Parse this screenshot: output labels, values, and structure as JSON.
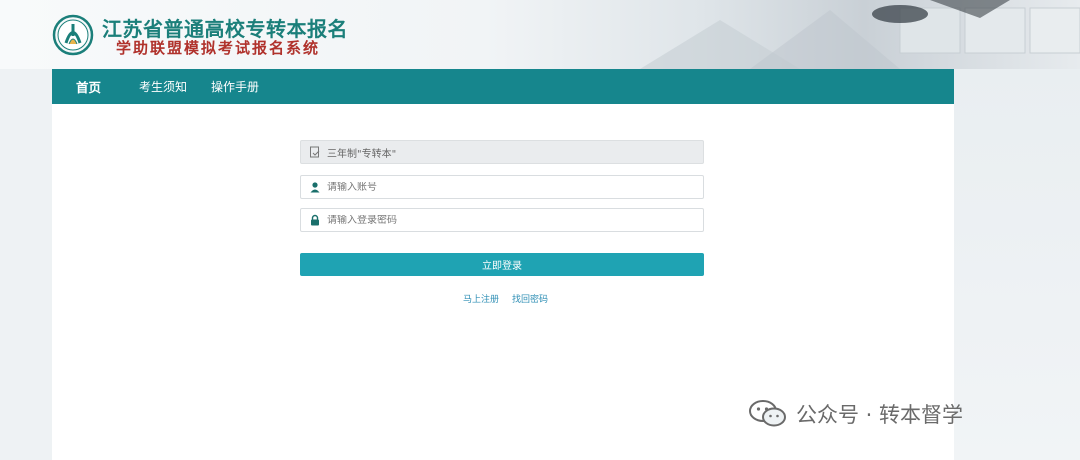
{
  "header": {
    "title": "江苏省普通高校专转本报名",
    "subtitle": "学助联盟模拟考试报名系统"
  },
  "nav": {
    "items": [
      {
        "label": "首页",
        "active": true
      },
      {
        "label": "考生须知"
      },
      {
        "label": "操作手册"
      }
    ]
  },
  "form": {
    "exam_type": "三年制\"专转本\"",
    "account_placeholder": "请输入账号",
    "password_placeholder": "请输入登录密码",
    "login_label": "立即登录",
    "register_label": "马上注册",
    "forgot_label": "找回密码"
  },
  "watermark": {
    "text": "公众号 · 转本督学"
  },
  "colors": {
    "nav": "#16868d",
    "title": "#1b7f7a",
    "subtitle": "#b0322c",
    "button": "#1fa3b3",
    "link": "#2f8fb5"
  },
  "icons": [
    "school-logo-icon",
    "document-icon",
    "user-icon",
    "lock-icon",
    "wechat-icon"
  ]
}
